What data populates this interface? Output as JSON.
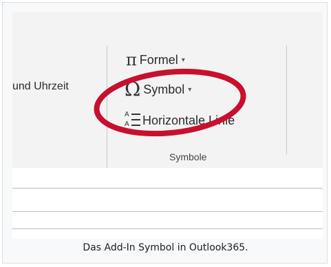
{
  "ribbon": {
    "previous_label": "und Uhrzeit",
    "commands": {
      "formel": {
        "label": "Formel",
        "icon": "pi-icon"
      },
      "symbol": {
        "label": "Symbol",
        "icon": "omega-icon"
      },
      "linie": {
        "label": "Horizontale Linie",
        "icon": "horizontal-line-icon"
      }
    },
    "group_label": "Symbole"
  },
  "caption": "Das Add-In Symbol in Outlook365.",
  "colors": {
    "annotation_ring": "#c8102e",
    "ribbon_bg": "#f3f3f3"
  }
}
